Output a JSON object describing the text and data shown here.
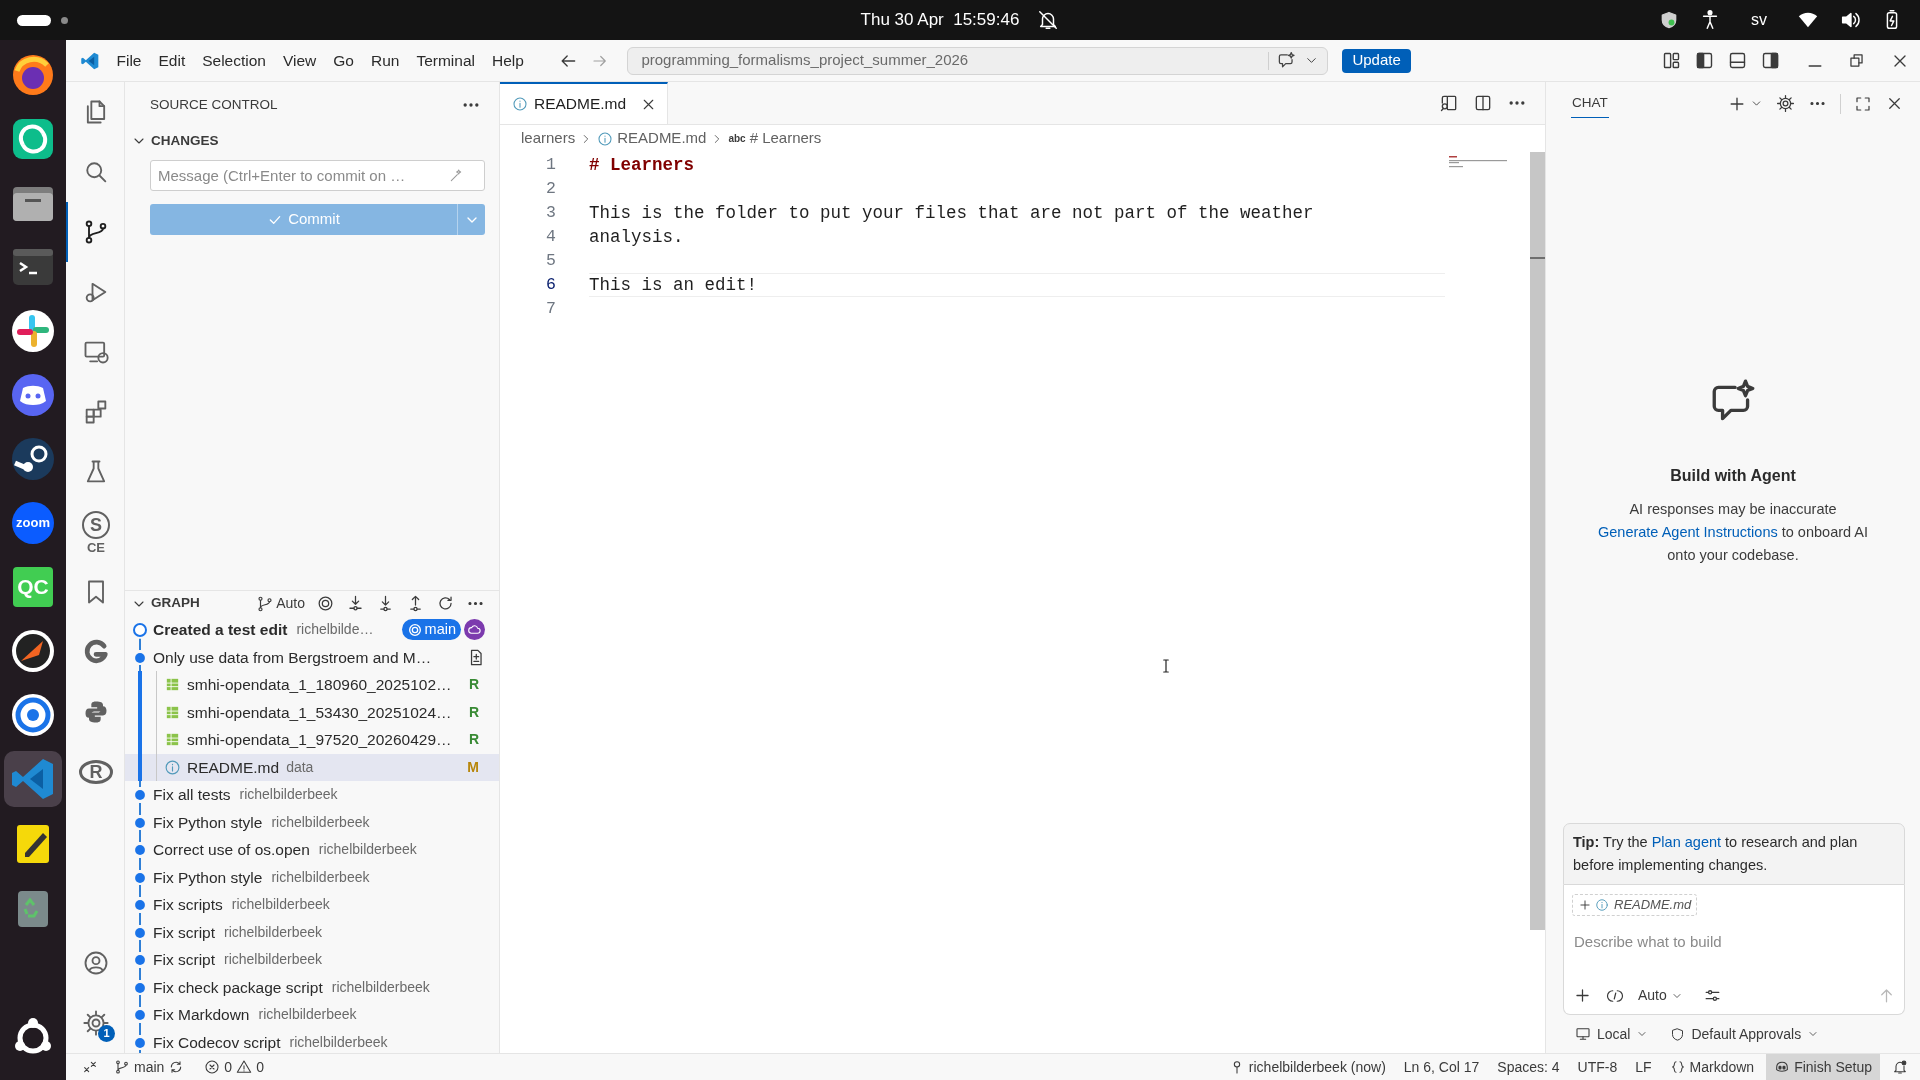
{
  "top_bar": {
    "clock": "Thu 30 Apr  15:59:46",
    "keyboard_layout": "sv"
  },
  "dock": [
    {
      "kind": "browser",
      "selected": false
    },
    {
      "kind": "chat",
      "selected": false
    },
    {
      "kind": "files",
      "selected": false
    },
    {
      "kind": "terminal",
      "selected": false
    },
    {
      "kind": "pinwheel",
      "selected": false
    },
    {
      "kind": "controller",
      "selected": false
    },
    {
      "kind": "piston",
      "selected": false
    },
    {
      "kind": "video",
      "label": "zoom",
      "selected": false
    },
    {
      "kind": "qc",
      "label": "QC",
      "selected": false
    },
    {
      "kind": "blade",
      "selected": false
    },
    {
      "kind": "ring",
      "selected": false
    },
    {
      "kind": "code",
      "selected": true
    },
    {
      "kind": "notepad",
      "selected": false
    },
    {
      "kind": "trash",
      "selected": false
    },
    {
      "kind": "apps",
      "selected": false
    }
  ],
  "menu": [
    "File",
    "Edit",
    "Selection",
    "View",
    "Go",
    "Run",
    "Terminal",
    "Help"
  ],
  "command_center": {
    "text": "programming_formalisms_project_summer_2026"
  },
  "update_button": "Update",
  "activity_bar": [
    {
      "kind": "explorer",
      "selected": false
    },
    {
      "kind": "search",
      "selected": false
    },
    {
      "kind": "scm",
      "selected": true
    },
    {
      "kind": "debug",
      "selected": false
    },
    {
      "kind": "remote",
      "selected": false
    },
    {
      "kind": "extensions",
      "selected": false
    },
    {
      "kind": "testing",
      "selected": false
    },
    {
      "kind": "sce",
      "symbol": "S",
      "label": "CE",
      "selected": false
    },
    {
      "kind": "bookmark",
      "selected": false
    },
    {
      "kind": "arc",
      "selected": false
    },
    {
      "kind": "python",
      "selected": false
    },
    {
      "kind": "rlogo",
      "symbol": "R",
      "selected": false
    }
  ],
  "activity_bar_bottom": [
    {
      "kind": "accounts"
    },
    {
      "kind": "settings",
      "badge": "1"
    }
  ],
  "source_control": {
    "title": "SOURCE CONTROL",
    "changes_title": "CHANGES",
    "message_placeholder": "Message (Ctrl+Enter to commit on …",
    "commit_button": "Commit"
  },
  "graph": {
    "title": "GRAPH",
    "mode": "Auto",
    "rows": [
      {
        "message": "Created a test edit",
        "author": "richelbilde…",
        "current": true,
        "branch": "main",
        "remote": true
      },
      {
        "message": "Only use data from Bergstroem and M…",
        "current": false,
        "remote": false,
        "children": [
          {
            "kind": "table",
            "name": "smhi-opendata_1_180960_2025102…",
            "status": "R",
            "color": "#388a34",
            "selected": false
          },
          {
            "kind": "table",
            "name": "smhi-opendata_1_53430_20251024…",
            "status": "R",
            "color": "#388a34",
            "selected": false
          },
          {
            "kind": "table",
            "name": "smhi-opendata_1_97520_20260429…",
            "status": "R",
            "color": "#388a34",
            "selected": false
          },
          {
            "kind": "info",
            "name": "README.md",
            "folder": "data",
            "status": "M",
            "color": "#b7860b",
            "selected": true
          }
        ]
      },
      {
        "message": "Fix all tests",
        "author": "richelbilderbeek",
        "current": false,
        "remote": false
      },
      {
        "message": "Fix Python style",
        "author": "richelbilderbeek",
        "current": false,
        "remote": false
      },
      {
        "message": "Correct use of os.open",
        "author": "richelbilderbeek",
        "current": false,
        "remote": false
      },
      {
        "message": "Fix Python style",
        "author": "richelbilderbeek",
        "current": false,
        "remote": false
      },
      {
        "message": "Fix scripts",
        "author": "richelbilderbeek",
        "current": false,
        "remote": false
      },
      {
        "message": "Fix script",
        "author": "richelbilderbeek",
        "current": false,
        "remote": false
      },
      {
        "message": "Fix script",
        "author": "richelbilderbeek",
        "current": false,
        "remote": false
      },
      {
        "message": "Fix check package script",
        "author": "richelbilderbeek",
        "current": false,
        "remote": false
      },
      {
        "message": "Fix Markdown",
        "author": "richelbilderbeek",
        "current": false,
        "remote": false
      },
      {
        "message": "Fix Codecov script",
        "author": "richelbilderbeek",
        "current": false,
        "remote": false
      }
    ]
  },
  "editor": {
    "tab": "README.md",
    "breadcrumb": {
      "folder": "learners",
      "file": "README.md",
      "symbol_kind": "abc",
      "symbol": "# Learners"
    },
    "lines": [
      {
        "number": "1",
        "text": "# Learners",
        "kind": "heading",
        "current": false
      },
      {
        "number": "2",
        "current": false
      },
      {
        "number": "3",
        "text": "This is the folder to put your files that are not part of the weather",
        "kind": "text",
        "current": false
      },
      {
        "number": "4",
        "text": "analysis.",
        "kind": "text",
        "current": false
      },
      {
        "number": "5",
        "current": false
      },
      {
        "number": "6",
        "text": "This is an edit!",
        "kind": "text",
        "current": true
      },
      {
        "number": "7",
        "current": false
      }
    ]
  },
  "chat": {
    "title": "CHAT",
    "heading": "Build with Agent",
    "disclaimer": "AI responses may be inaccurate",
    "instructions_link": "Generate Agent Instructions",
    "instructions_rest": "to onboard AI onto your codebase.",
    "tip": {
      "label": "Tip:",
      "before_link": "Try the",
      "link": "Plan agent",
      "after_link": "to research and plan before implementing changes."
    },
    "context_file": "README.md",
    "input_placeholder": "Describe what to build",
    "mode": "Auto",
    "location": "Local",
    "approvals": "Default Approvals"
  },
  "status_bar": {
    "branch": "main",
    "errors": "0",
    "warnings": "0",
    "last_commit": "richelbilderbeek (now)",
    "cursor": "Ln 6, Col 17",
    "indentation": "Spaces: 4",
    "encoding": "UTF-8",
    "line_ending": "LF",
    "language": "Markdown",
    "setup": "Finish Setup"
  }
}
